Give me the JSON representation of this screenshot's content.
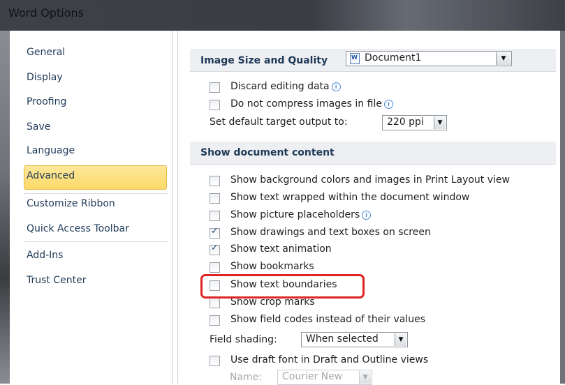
{
  "window": {
    "title": "Word Options"
  },
  "nav": {
    "items": [
      {
        "label": "General"
      },
      {
        "label": "Display"
      },
      {
        "label": "Proofing"
      },
      {
        "label": "Save"
      },
      {
        "label": "Language"
      },
      {
        "label": "Advanced",
        "selected": true
      },
      {
        "label": "Customize Ribbon"
      },
      {
        "label": "Quick Access Toolbar"
      },
      {
        "label": "Add-Ins"
      },
      {
        "label": "Trust Center"
      }
    ]
  },
  "image_section": {
    "title": "Image Size and Quality",
    "document_select": "Document1",
    "discard_editing": "Discard editing data",
    "no_compress": "Do not compress images in file",
    "target_output_label": "Set default target output to:",
    "target_output_value": "220 ppi"
  },
  "content_section": {
    "title": "Show document content",
    "options": [
      {
        "label": "Show background colors and images in Print Layout view",
        "checked": false
      },
      {
        "label": "Show text wrapped within the document window",
        "checked": false
      },
      {
        "label": "Show picture placeholders",
        "checked": false
      },
      {
        "label": "Show drawings and text boxes on screen",
        "checked": true
      },
      {
        "label": "Show text animation",
        "checked": true
      },
      {
        "label": "Show bookmarks",
        "checked": false
      },
      {
        "label": "Show text boundaries",
        "checked": false
      },
      {
        "label": "Show crop marks",
        "checked": false
      },
      {
        "label": "Show field codes instead of their values",
        "checked": false
      }
    ],
    "field_shading_label": "Field shading:",
    "field_shading_value": "When selected",
    "draft_font_label": "Use draft font in Draft and Outline views",
    "name_label": "Name:",
    "name_value": "Courier New"
  },
  "colors": {
    "accent": "#fcd968",
    "highlight": "#e02424"
  }
}
